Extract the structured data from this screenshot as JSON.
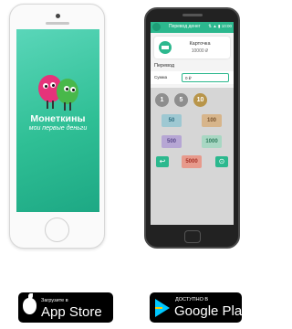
{
  "ios_app": {
    "title": "Монеткины",
    "subtitle": "мои первые деньги"
  },
  "android_app": {
    "header_title": "Перевод денег",
    "status_text": "⇅ ▲ ▮ 10:00",
    "card": {
      "name": "Карточка",
      "balance": "10000 ₽"
    },
    "section_label": "Перевод",
    "amount": {
      "label": "Сумма",
      "value": "0 ₽"
    },
    "coins": [
      "1",
      "5",
      "10"
    ],
    "notes": [
      "50",
      "100",
      "500",
      "1000",
      "5000"
    ],
    "actions": {
      "back": "↩",
      "confirm": "⊙"
    }
  },
  "store_badges": {
    "app_store": {
      "small": "Загрузите в",
      "big": "App Store"
    },
    "google_play": {
      "small": "ДОСТУПНО В",
      "big": "Google Play"
    }
  }
}
